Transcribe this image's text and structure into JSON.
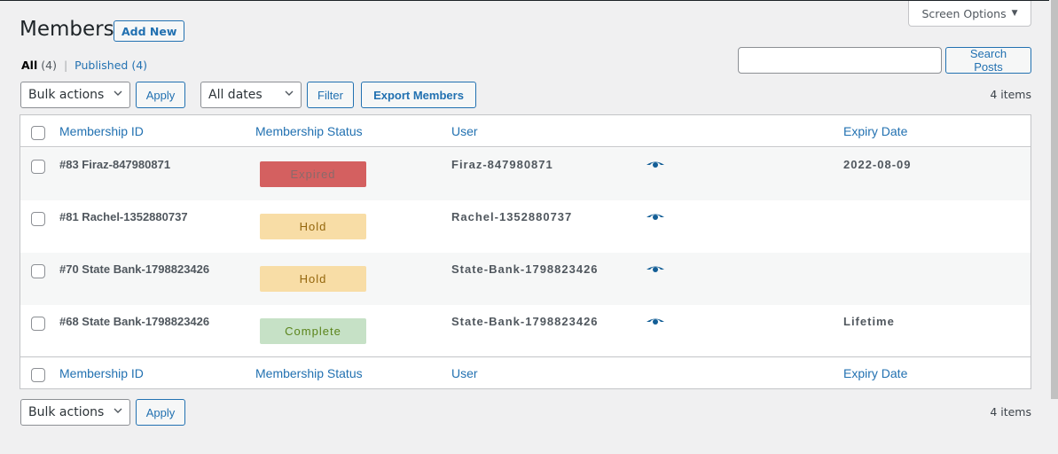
{
  "header": {
    "title": "Members",
    "add_new_label": "Add New",
    "screen_options_label": "Screen Options",
    "screen_options_arrow": "▼"
  },
  "views": {
    "all_label": "All",
    "all_count": "(4)",
    "separator": "|",
    "published_label": "Published",
    "published_count": "(4)"
  },
  "search": {
    "value": "",
    "placeholder": "",
    "button_label": "Search Posts"
  },
  "toolbar_top": {
    "bulk_actions_selected": "Bulk actions",
    "apply_label": "Apply",
    "dates_selected": "All dates",
    "filter_label": "Filter",
    "export_label": "Export Members",
    "items_count": "4 items"
  },
  "toolbar_bottom": {
    "bulk_actions_selected": "Bulk actions",
    "apply_label": "Apply",
    "items_count": "4 items"
  },
  "table": {
    "columns": [
      "Membership ID",
      "Membership Status",
      "User",
      "",
      "Expiry Date"
    ],
    "rows": [
      {
        "id": "#83 Firaz-847980871",
        "status": "Expired",
        "user": "Firaz-847980871",
        "action_icon": "eye-icon",
        "expiry": "2022-08-09"
      },
      {
        "id": "#81 Rachel-1352880737",
        "status": "Hold",
        "user": "Rachel-1352880737",
        "action_icon": "eye-icon",
        "expiry": ""
      },
      {
        "id": "#70 State Bank-1798823426",
        "status": "Hold",
        "user": "State-Bank-1798823426",
        "action_icon": "eye-icon",
        "expiry": ""
      },
      {
        "id": "#68 State Bank-1798823426",
        "status": "Complete",
        "user": "State-Bank-1798823426",
        "action_icon": "eye-icon",
        "expiry": "Lifetime"
      }
    ]
  },
  "status_colors": {
    "Expired": {
      "bg": "#d46060",
      "fg": "#8a6a6a"
    },
    "Hold": {
      "bg": "#f8dda6",
      "fg": "#94660c"
    },
    "Complete": {
      "bg": "#c6e1c6",
      "fg": "#5b841b"
    }
  },
  "colors": {
    "accent": "#2271b1",
    "icon": "#135e96"
  }
}
